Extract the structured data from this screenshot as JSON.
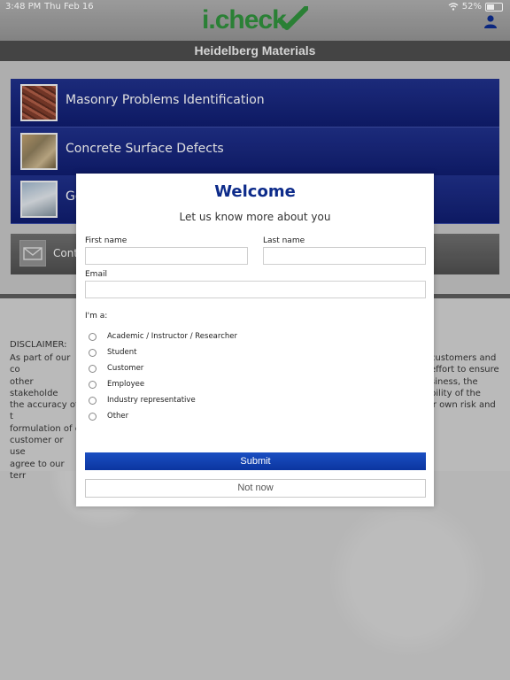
{
  "status_bar": {
    "time": "3:48 PM",
    "date": "Thu Feb 16",
    "battery": "52%",
    "wifi_icon": "wifi-icon",
    "battery_icon": "battery-icon"
  },
  "header": {
    "logo_i": "i",
    "logo_dot": ".",
    "logo_check": "check",
    "logo_mark_icon": "checkmark-icon",
    "user_icon": "user-icon",
    "subtitle": "Heidelberg Materials"
  },
  "menu": {
    "items": [
      {
        "label": "Masonry Problems Identification",
        "icon": "masonry-thumbnail"
      },
      {
        "label": "Concrete Surface Defects",
        "icon": "concrete-thumbnail"
      },
      {
        "label": "Go",
        "icon": "aggregates-thumbnail"
      }
    ],
    "contact_label": "Cont",
    "contact_icon": "mail-icon"
  },
  "disclaimer": {
    "title": "DISCLAIMER:",
    "left_lines": [
      "As part of our co",
      "other stakeholde",
      "the accuracy of t",
      "formulation of c",
      "customer or use",
      "agree to our terr"
    ],
    "right_lines": [
      "customers and",
      "effort to ensure",
      "siness, the",
      "bility of the",
      "ir own risk and",
      ""
    ]
  },
  "modal": {
    "title": "Welcome",
    "subtitle": "Let us know more about you",
    "first_name_label": "First name",
    "first_name_value": "",
    "last_name_label": "Last name",
    "last_name_value": "",
    "email_label": "Email",
    "email_value": "",
    "role_label": "I'm a:",
    "roles": [
      "Academic / Instructor / Researcher",
      "Student",
      "Customer",
      "Employee",
      "Industry representative",
      "Other"
    ],
    "submit_label": "Submit",
    "not_now_label": "Not now"
  },
  "colors": {
    "brand_blue": "#0d2b8a",
    "brand_green": "#2e8b3a",
    "menu_blue": "#1a2a80",
    "submit_blue": "#0b35a0"
  }
}
